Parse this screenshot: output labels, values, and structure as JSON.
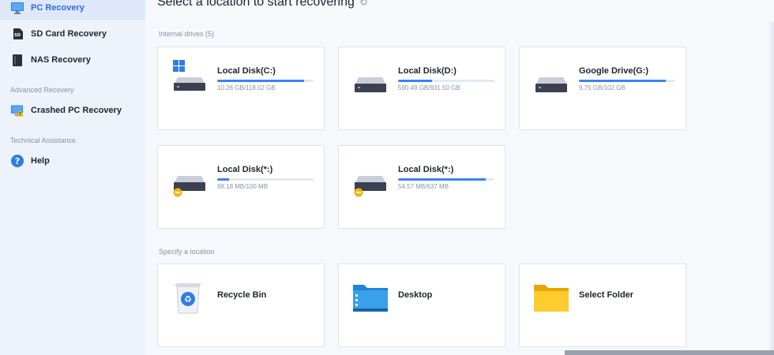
{
  "sidebar": {
    "items": [
      {
        "label": "PC Recovery",
        "icon": "monitor-icon",
        "active": true
      },
      {
        "label": "SD Card Recovery",
        "icon": "sd-card-icon"
      },
      {
        "label": "NAS Recovery",
        "icon": "nas-icon"
      }
    ],
    "advanced_label": "Advanced Recovery",
    "advanced_items": [
      {
        "label": "Crashed PC Recovery",
        "icon": "crashed-pc-icon"
      }
    ],
    "technical_label": "Technical Assistance",
    "technical_items": [
      {
        "label": "Help",
        "icon": "help-icon"
      }
    ]
  },
  "main": {
    "title": "Select a location to start recovering",
    "internal_label": "Internal drives (5)",
    "drives": [
      {
        "name": "Local Disk(C:)",
        "size": "10.26 GB/118.02 GB",
        "usage": 0.9,
        "icon": "windows-drive-icon"
      },
      {
        "name": "Local Disk(D:)",
        "size": "590.49 GB/931.50 GB",
        "usage": 0.35,
        "icon": "drive-icon"
      },
      {
        "name": "Google Drive(G:)",
        "size": "9.75 GB/102 GB",
        "usage": 0.9,
        "icon": "drive-icon"
      },
      {
        "name": "Local Disk(*:)",
        "size": "88.18 MB/100 MB",
        "usage": 0.12,
        "icon": "drive-warning-icon"
      },
      {
        "name": "Local Disk(*:)",
        "size": "54.57 MB/637 MB",
        "usage": 0.91,
        "icon": "drive-warning-icon"
      }
    ],
    "specify_label": "Specify a location",
    "locations": [
      {
        "name": "Recycle Bin",
        "icon": "recycle-bin-icon"
      },
      {
        "name": "Desktop",
        "icon": "desktop-folder-icon"
      },
      {
        "name": "Select Folder",
        "icon": "folder-icon"
      }
    ]
  },
  "colors": {
    "accent": "#2d6cdf",
    "progress": "#3b82f6",
    "sidebar_bg": "#eef2fb",
    "active_bg": "#dfe8fa"
  }
}
